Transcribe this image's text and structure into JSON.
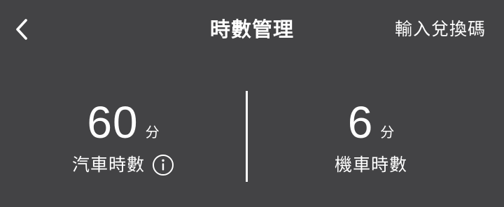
{
  "header": {
    "title": "時數管理",
    "redeem_label": "輸入兌換碼",
    "back_icon": "chevron-left-icon"
  },
  "stats": {
    "car": {
      "value": "60",
      "unit": "分",
      "label": "汽車時數",
      "info_icon": "info-icon"
    },
    "scooter": {
      "value": "6",
      "unit": "分",
      "label": "機車時數"
    }
  },
  "colors": {
    "background": "#434345",
    "foreground": "#ffffff"
  }
}
